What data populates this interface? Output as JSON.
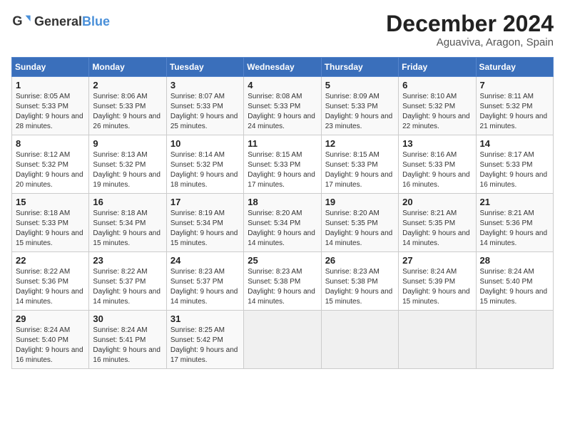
{
  "header": {
    "logo_general": "General",
    "logo_blue": "Blue",
    "month": "December 2024",
    "location": "Aguaviva, Aragon, Spain"
  },
  "weekdays": [
    "Sunday",
    "Monday",
    "Tuesday",
    "Wednesday",
    "Thursday",
    "Friday",
    "Saturday"
  ],
  "weeks": [
    [
      {
        "day": "1",
        "sunrise": "8:05 AM",
        "sunset": "5:33 PM",
        "daylight": "9 hours and 28 minutes."
      },
      {
        "day": "2",
        "sunrise": "8:06 AM",
        "sunset": "5:33 PM",
        "daylight": "9 hours and 26 minutes."
      },
      {
        "day": "3",
        "sunrise": "8:07 AM",
        "sunset": "5:33 PM",
        "daylight": "9 hours and 25 minutes."
      },
      {
        "day": "4",
        "sunrise": "8:08 AM",
        "sunset": "5:33 PM",
        "daylight": "9 hours and 24 minutes."
      },
      {
        "day": "5",
        "sunrise": "8:09 AM",
        "sunset": "5:33 PM",
        "daylight": "9 hours and 23 minutes."
      },
      {
        "day": "6",
        "sunrise": "8:10 AM",
        "sunset": "5:32 PM",
        "daylight": "9 hours and 22 minutes."
      },
      {
        "day": "7",
        "sunrise": "8:11 AM",
        "sunset": "5:32 PM",
        "daylight": "9 hours and 21 minutes."
      }
    ],
    [
      {
        "day": "8",
        "sunrise": "8:12 AM",
        "sunset": "5:32 PM",
        "daylight": "9 hours and 20 minutes."
      },
      {
        "day": "9",
        "sunrise": "8:13 AM",
        "sunset": "5:32 PM",
        "daylight": "9 hours and 19 minutes."
      },
      {
        "day": "10",
        "sunrise": "8:14 AM",
        "sunset": "5:32 PM",
        "daylight": "9 hours and 18 minutes."
      },
      {
        "day": "11",
        "sunrise": "8:15 AM",
        "sunset": "5:33 PM",
        "daylight": "9 hours and 17 minutes."
      },
      {
        "day": "12",
        "sunrise": "8:15 AM",
        "sunset": "5:33 PM",
        "daylight": "9 hours and 17 minutes."
      },
      {
        "day": "13",
        "sunrise": "8:16 AM",
        "sunset": "5:33 PM",
        "daylight": "9 hours and 16 minutes."
      },
      {
        "day": "14",
        "sunrise": "8:17 AM",
        "sunset": "5:33 PM",
        "daylight": "9 hours and 16 minutes."
      }
    ],
    [
      {
        "day": "15",
        "sunrise": "8:18 AM",
        "sunset": "5:33 PM",
        "daylight": "9 hours and 15 minutes."
      },
      {
        "day": "16",
        "sunrise": "8:18 AM",
        "sunset": "5:34 PM",
        "daylight": "9 hours and 15 minutes."
      },
      {
        "day": "17",
        "sunrise": "8:19 AM",
        "sunset": "5:34 PM",
        "daylight": "9 hours and 15 minutes."
      },
      {
        "day": "18",
        "sunrise": "8:20 AM",
        "sunset": "5:34 PM",
        "daylight": "9 hours and 14 minutes."
      },
      {
        "day": "19",
        "sunrise": "8:20 AM",
        "sunset": "5:35 PM",
        "daylight": "9 hours and 14 minutes."
      },
      {
        "day": "20",
        "sunrise": "8:21 AM",
        "sunset": "5:35 PM",
        "daylight": "9 hours and 14 minutes."
      },
      {
        "day": "21",
        "sunrise": "8:21 AM",
        "sunset": "5:36 PM",
        "daylight": "9 hours and 14 minutes."
      }
    ],
    [
      {
        "day": "22",
        "sunrise": "8:22 AM",
        "sunset": "5:36 PM",
        "daylight": "9 hours and 14 minutes."
      },
      {
        "day": "23",
        "sunrise": "8:22 AM",
        "sunset": "5:37 PM",
        "daylight": "9 hours and 14 minutes."
      },
      {
        "day": "24",
        "sunrise": "8:23 AM",
        "sunset": "5:37 PM",
        "daylight": "9 hours and 14 minutes."
      },
      {
        "day": "25",
        "sunrise": "8:23 AM",
        "sunset": "5:38 PM",
        "daylight": "9 hours and 14 minutes."
      },
      {
        "day": "26",
        "sunrise": "8:23 AM",
        "sunset": "5:38 PM",
        "daylight": "9 hours and 15 minutes."
      },
      {
        "day": "27",
        "sunrise": "8:24 AM",
        "sunset": "5:39 PM",
        "daylight": "9 hours and 15 minutes."
      },
      {
        "day": "28",
        "sunrise": "8:24 AM",
        "sunset": "5:40 PM",
        "daylight": "9 hours and 15 minutes."
      }
    ],
    [
      {
        "day": "29",
        "sunrise": "8:24 AM",
        "sunset": "5:40 PM",
        "daylight": "9 hours and 16 minutes."
      },
      {
        "day": "30",
        "sunrise": "8:24 AM",
        "sunset": "5:41 PM",
        "daylight": "9 hours and 16 minutes."
      },
      {
        "day": "31",
        "sunrise": "8:25 AM",
        "sunset": "5:42 PM",
        "daylight": "9 hours and 17 minutes."
      },
      null,
      null,
      null,
      null
    ]
  ]
}
